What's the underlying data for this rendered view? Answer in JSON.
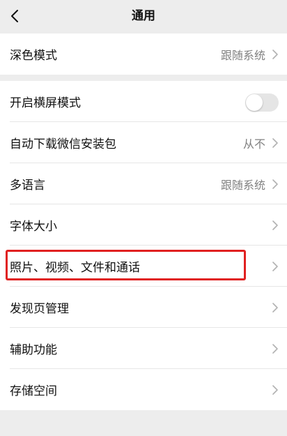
{
  "header": {
    "title": "通用",
    "back_icon": "chevron-left-icon"
  },
  "group1": [
    {
      "label": "深色模式",
      "value": "跟随系统"
    }
  ],
  "group2": [
    {
      "label": "开启横屏模式",
      "toggle": false
    },
    {
      "label": "自动下载微信安装包",
      "value": "从不"
    },
    {
      "label": "多语言",
      "value": "跟随系统"
    },
    {
      "label": "字体大小"
    },
    {
      "label": "照片、视频、文件和通话"
    },
    {
      "label": "发现页管理"
    },
    {
      "label": "辅助功能"
    },
    {
      "label": "存储空间"
    }
  ],
  "colors": {
    "background": "#ededed",
    "cell_background": "#ffffff",
    "secondary_text": "#808080",
    "highlight_border": "#e02020",
    "toggle_off": "#e5e5e5"
  },
  "annotation": {
    "highlighted_item": "照片、视频、文件和通话"
  }
}
